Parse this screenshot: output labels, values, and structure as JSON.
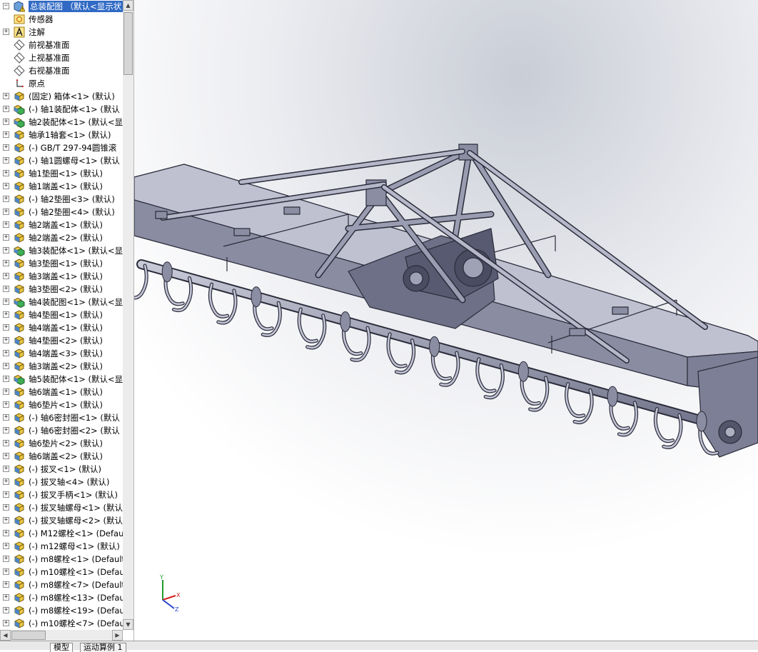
{
  "tree": {
    "rows": [
      {
        "label": "总装配图 （默认<显示状",
        "icon": "assembly-warning-icon",
        "expander": "minus",
        "selected": true
      },
      {
        "label": "传感器",
        "icon": "sensor-folder-icon",
        "expander": "none"
      },
      {
        "label": "注解",
        "icon": "annotation-icon",
        "expander": "plus"
      },
      {
        "label": "前视基准面",
        "icon": "plane-icon",
        "expander": "none"
      },
      {
        "label": "上视基准面",
        "icon": "plane-icon",
        "expander": "none"
      },
      {
        "label": "右视基准面",
        "icon": "plane-icon",
        "expander": "none"
      },
      {
        "label": "原点",
        "icon": "origin-icon",
        "expander": "none"
      },
      {
        "label": "(固定) 箱体<1> (默认)",
        "icon": "part-icon",
        "expander": "plus"
      },
      {
        "label": "(-) 轴1装配体<1> (默认",
        "icon": "subassembly-icon",
        "expander": "plus"
      },
      {
        "label": "轴2装配体<1> (默认<显",
        "icon": "subassembly-icon",
        "expander": "plus"
      },
      {
        "label": "轴承1轴套<1> (默认)",
        "icon": "part-icon",
        "expander": "plus"
      },
      {
        "label": "(-) GB/T 297-94圆锥滚",
        "icon": "part-icon",
        "expander": "plus"
      },
      {
        "label": "(-) 轴1圆螺母<1> (默认",
        "icon": "part-icon",
        "expander": "plus"
      },
      {
        "label": "轴1垫圈<1> (默认)",
        "icon": "part-icon",
        "expander": "plus"
      },
      {
        "label": "轴1端盖<1> (默认)",
        "icon": "part-icon",
        "expander": "plus"
      },
      {
        "label": "(-) 轴2垫圈<3> (默认)",
        "icon": "part-icon",
        "expander": "plus"
      },
      {
        "label": "(-) 轴2垫圈<4> (默认)",
        "icon": "part-icon",
        "expander": "plus"
      },
      {
        "label": "轴2端盖<1> (默认)",
        "icon": "part-icon",
        "expander": "plus"
      },
      {
        "label": "轴2端盖<2> (默认)",
        "icon": "part-icon",
        "expander": "plus"
      },
      {
        "label": "轴3装配体<1> (默认<显示",
        "icon": "subassembly-icon",
        "expander": "plus"
      },
      {
        "label": "轴3垫圈<1> (默认)",
        "icon": "part-icon",
        "expander": "plus"
      },
      {
        "label": "轴3端盖<1> (默认)",
        "icon": "part-icon",
        "expander": "plus"
      },
      {
        "label": "轴3垫圈<2> (默认)",
        "icon": "part-icon",
        "expander": "plus"
      },
      {
        "label": "轴4装配图<1> (默认<显示",
        "icon": "subassembly-icon",
        "expander": "plus"
      },
      {
        "label": "轴4垫圈<1> (默认)",
        "icon": "part-icon",
        "expander": "plus"
      },
      {
        "label": "轴4端盖<1> (默认)",
        "icon": "part-icon",
        "expander": "plus"
      },
      {
        "label": "轴4垫圈<2> (默认)",
        "icon": "part-icon",
        "expander": "plus"
      },
      {
        "label": "轴4端盖<3> (默认)",
        "icon": "part-icon",
        "expander": "plus"
      },
      {
        "label": "轴3端盖<2> (默认)",
        "icon": "part-icon",
        "expander": "plus"
      },
      {
        "label": "轴5装配体<1> (默认<显示",
        "icon": "subassembly-icon",
        "expander": "plus"
      },
      {
        "label": "轴6端盖<1> (默认)",
        "icon": "part-icon",
        "expander": "plus"
      },
      {
        "label": "轴6垫片<1> (默认)",
        "icon": "part-icon",
        "expander": "plus"
      },
      {
        "label": "(-) 轴6密封圈<1> (默认",
        "icon": "part-icon",
        "expander": "plus"
      },
      {
        "label": "(-) 轴6密封圈<2> (默认",
        "icon": "part-icon",
        "expander": "plus"
      },
      {
        "label": "轴6垫片<2> (默认)",
        "icon": "part-icon",
        "expander": "plus"
      },
      {
        "label": "轴6端盖<2> (默认)",
        "icon": "part-icon",
        "expander": "plus"
      },
      {
        "label": "(-) 拔叉<1> (默认)",
        "icon": "part-icon",
        "expander": "plus"
      },
      {
        "label": "(-) 拔叉轴<4> (默认)",
        "icon": "part-icon",
        "expander": "plus"
      },
      {
        "label": "(-) 拔叉手柄<1> (默认)",
        "icon": "part-icon",
        "expander": "plus"
      },
      {
        "label": "(-) 拔叉轴螺母<1> (默认",
        "icon": "part-icon",
        "expander": "plus"
      },
      {
        "label": "(-) 拔叉轴螺母<2> (默认",
        "icon": "part-icon",
        "expander": "plus"
      },
      {
        "label": "(-) M12螺栓<1> (Defaul",
        "icon": "part-icon",
        "expander": "plus"
      },
      {
        "label": "(-) m12螺母<1> (默认)",
        "icon": "part-icon",
        "expander": "plus"
      },
      {
        "label": "(-) m8螺栓<1> (Default",
        "icon": "part-icon",
        "expander": "plus"
      },
      {
        "label": "(-) m10螺栓<1> (Defaul",
        "icon": "part-icon",
        "expander": "plus"
      },
      {
        "label": "(-) m8螺栓<7> (Default",
        "icon": "part-icon",
        "expander": "plus"
      },
      {
        "label": "(-) m8螺栓<13> (Defaul",
        "icon": "part-icon",
        "expander": "plus"
      },
      {
        "label": "(-) m8螺栓<19> (Defaul",
        "icon": "part-icon",
        "expander": "plus"
      },
      {
        "label": "(-) m10螺栓<7> (Defaul",
        "icon": "part-icon",
        "expander": "plus"
      }
    ]
  },
  "tabs": [
    {
      "label": "模型"
    },
    {
      "label": "运动算例 1"
    }
  ],
  "triad": {
    "x_label": "X",
    "y_label": "Y",
    "z_label": "Z"
  },
  "colors": {
    "accent": "#316ac5",
    "model_fill": "#9a9cb1",
    "model_dark": "#60627a",
    "model_light": "#c3c5d6",
    "axis_x": "#d42020",
    "axis_y": "#1f9a2b",
    "axis_z": "#2844c8"
  }
}
